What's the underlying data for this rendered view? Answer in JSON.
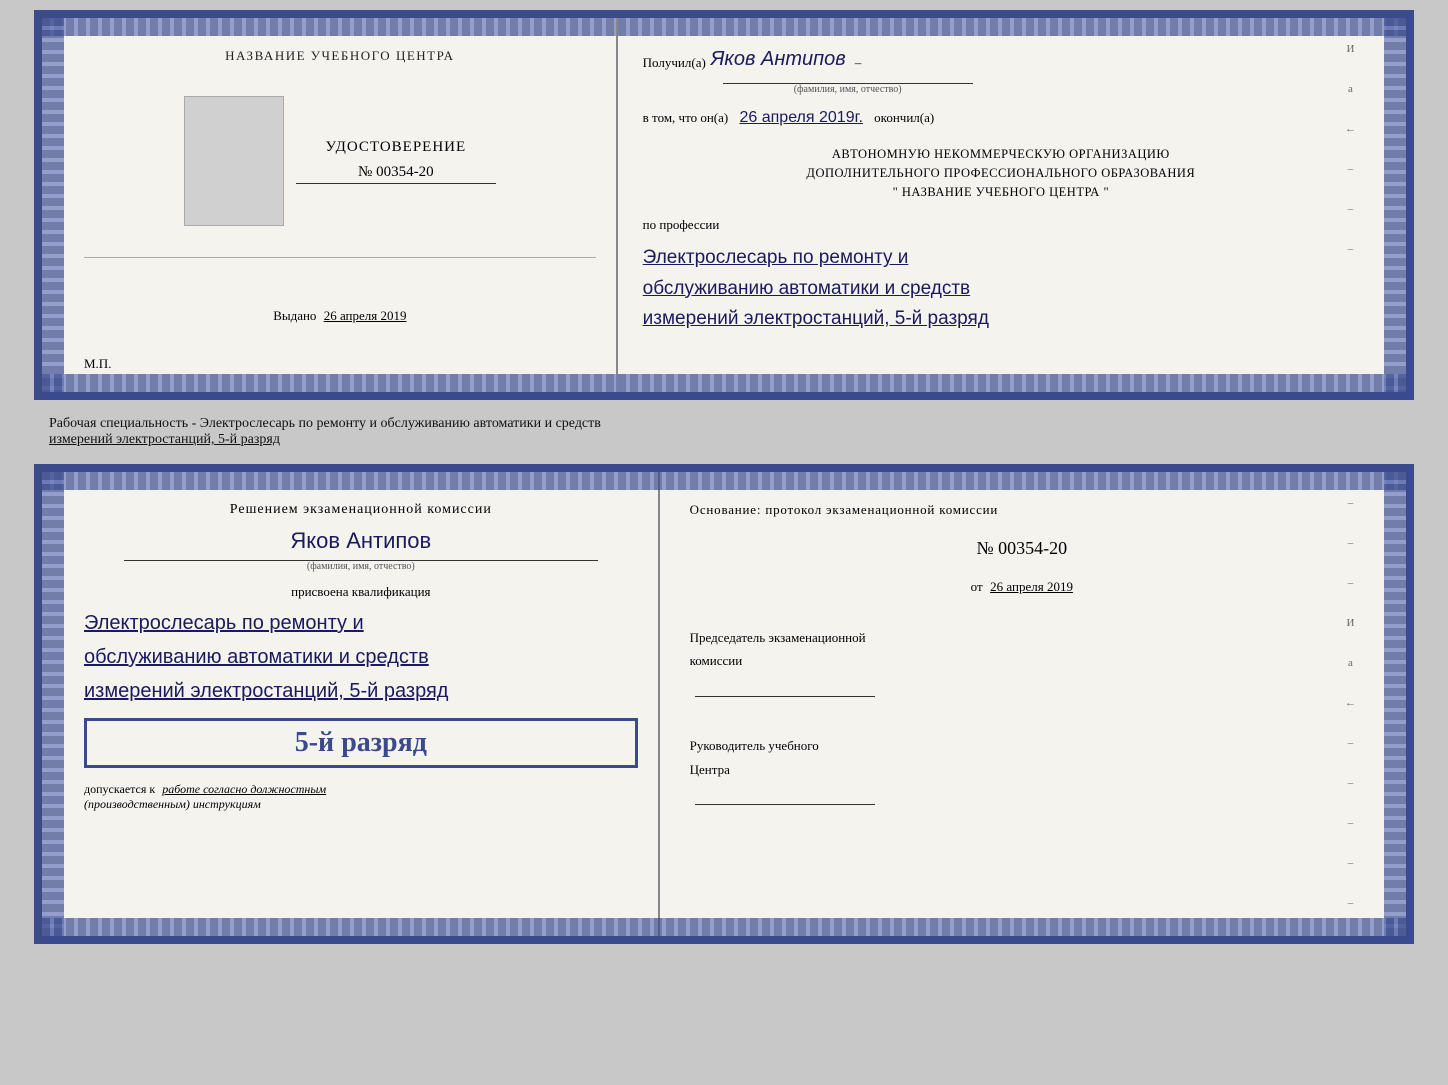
{
  "topDoc": {
    "left": {
      "centerTitle": "НАЗВАНИЕ УЧЕБНОГО ЦЕНТРА",
      "certTitle": "УДОСТОВЕРЕНИЕ",
      "certNumber": "№ 00354-20",
      "issuedLabel": "Выдано",
      "issuedDate": "26 апреля 2019",
      "mpLabel": "М.П."
    },
    "right": {
      "receivedLabel": "Получил(а)",
      "recipientName": "Яков Антипов",
      "fioLabel": "(фамилия, имя, отчество)",
      "inThatLabel": "в том, что он(а)",
      "date": "26 апреля 2019г.",
      "finishedLabel": "окончил(а)",
      "orgLine1": "АВТОНОМНУЮ НЕКОММЕРЧЕСКУЮ ОРГАНИЗАЦИЮ",
      "orgLine2": "ДОПОЛНИТЕЛЬНОГО ПРОФЕССИОНАЛЬНОГО ОБРАЗОВАНИЯ",
      "orgLine3": "\"  НАЗВАНИЕ УЧЕБНОГО ЦЕНТРА  \"",
      "professionLabel": "по профессии",
      "profession1": "Электрослесарь по ремонту и",
      "profession2": "обслуживанию автоматики и средств",
      "profession3": "измерений электростанций, 5-й разряд"
    }
  },
  "middleText": {
    "line1": "Рабочая специальность - Электрослесарь по ремонту и обслуживанию автоматики и средств",
    "line2": "измерений электростанций, 5-й разряд"
  },
  "bottomDoc": {
    "left": {
      "commissionTitle": "Решением экзаменационной комиссии",
      "personName": "Яков Антипов",
      "fioLabel": "(фамилия, имя, отчество)",
      "assignedText": "присвоена квалификация",
      "qual1": "Электрослесарь по ремонту и",
      "qual2": "обслуживанию автоматики и средств",
      "qual3": "измерений электростанций, 5-й разряд",
      "gradeLabel": "5-й разряд",
      "allowedLabel": "допускается к",
      "allowedText": "работе согласно должностным",
      "allowedText2": "(производственным) инструкциям"
    },
    "right": {
      "basisLabel": "Основание: протокол экзаменационной  комиссии",
      "protocolNumber": "№  00354-20",
      "protocolDatePrefix": "от",
      "protocolDate": "26 апреля 2019",
      "chairmanTitle": "Председатель экзаменационной",
      "chairmanTitle2": "комиссии",
      "managerTitle": "Руководитель учебного",
      "managerTitle2": "Центра",
      "decoLetters": [
        "И",
        "а",
        "←",
        "–",
        "–",
        "–",
        "–",
        "–"
      ]
    }
  }
}
